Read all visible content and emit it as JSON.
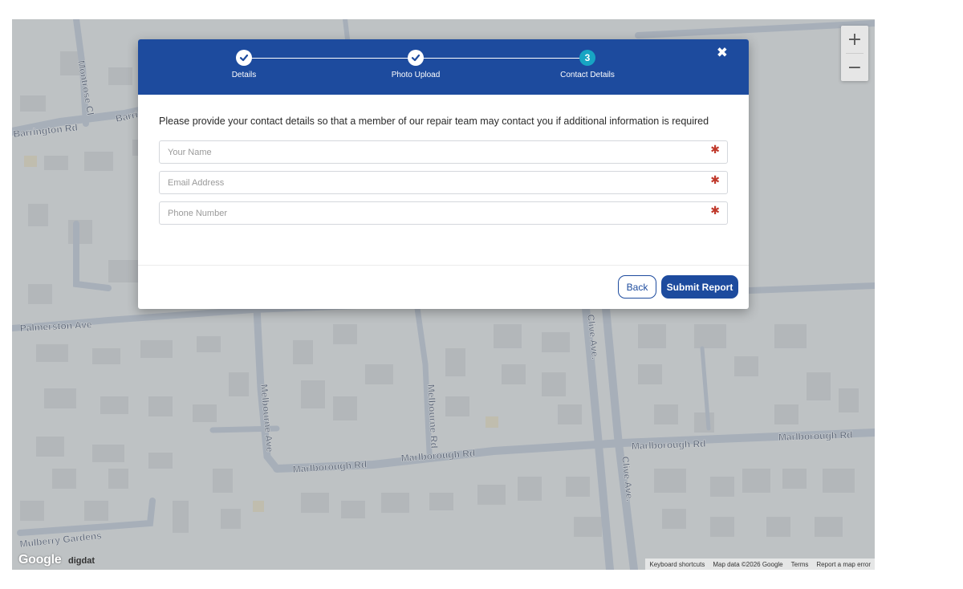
{
  "map": {
    "street_labels": [
      "Barrington Rd",
      "Barrington Rd",
      "Montrose Cl",
      "Palmerston Ave",
      "Melbourne Ave",
      "Melbourne Rd",
      "Marlborough Rd",
      "Marlborough Rd",
      "Marlborough Rd",
      "Marlborough Rd",
      "Clive Ave.",
      "Clive Ave.",
      "Mulberry Gardens"
    ],
    "zoom_in": "+",
    "zoom_out": "−",
    "google_logo": "Google",
    "digdat_logo": "digdat",
    "footer": {
      "keyboard": "Keyboard shortcuts",
      "map_data": "Map data ©2026 Google",
      "terms": "Terms",
      "report": "Report a map error"
    }
  },
  "modal": {
    "steps": [
      {
        "label": "Details",
        "state": "done",
        "icon": "check-icon"
      },
      {
        "label": "Photo Upload",
        "state": "done",
        "icon": "check-icon"
      },
      {
        "label": "Contact Details",
        "state": "current",
        "number": "3"
      }
    ],
    "close_icon": "close-icon",
    "intro": "Please provide your contact details so that a member of our repair team may contact you if additional information is required",
    "fields": {
      "name_placeholder": "Your Name",
      "email_placeholder": "Email Address",
      "phone_placeholder": "Phone Number",
      "required_mark": "✱"
    },
    "buttons": {
      "back": "Back",
      "submit": "Submit Report"
    }
  },
  "colors": {
    "header_blue": "#1d4b9e",
    "step_current": "#17a5c3",
    "required_red": "#c0392b"
  }
}
